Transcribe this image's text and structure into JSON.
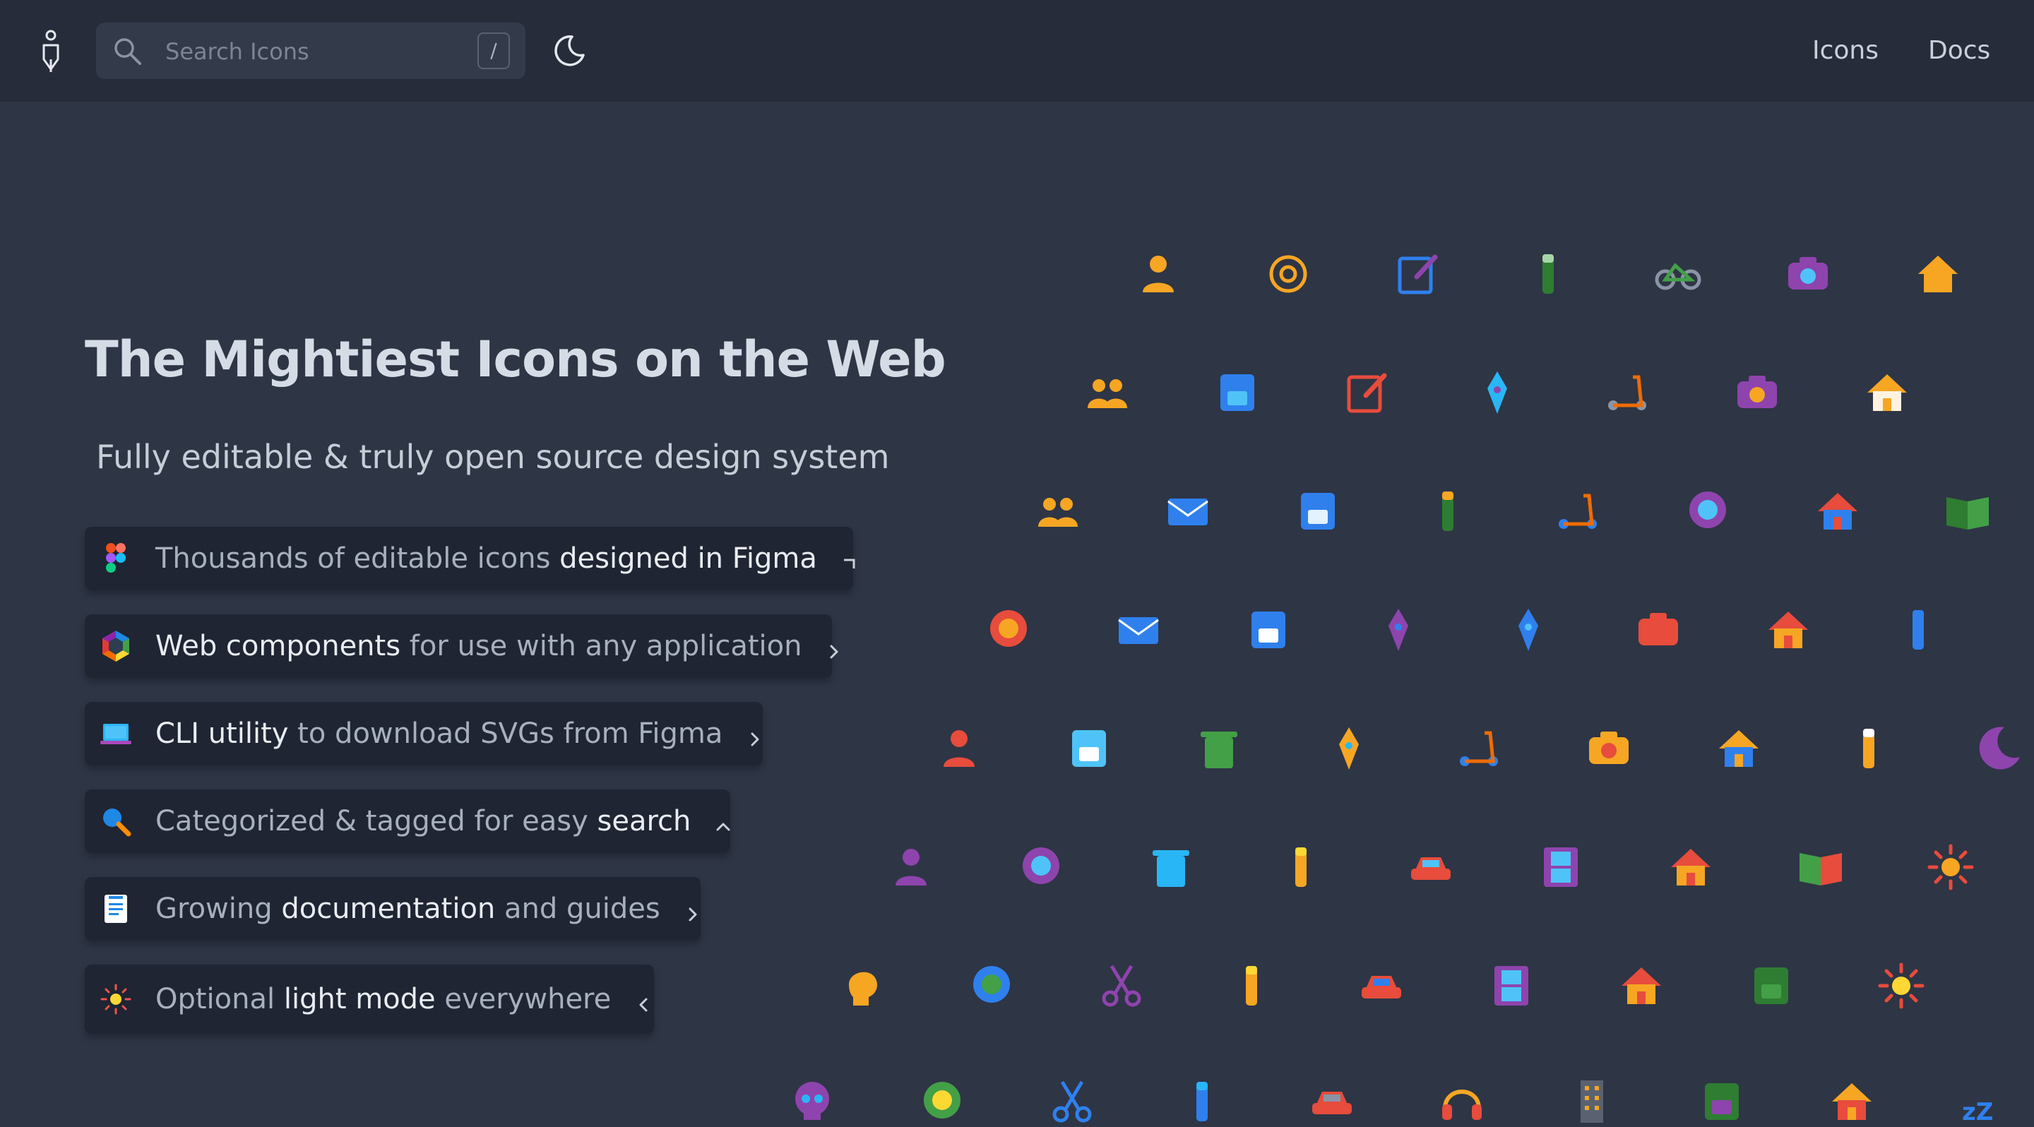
{
  "header": {
    "logo_icon": "pen-nib-logo-icon",
    "search": {
      "placeholder": "Search Icons",
      "value": "",
      "shortcut": "/"
    },
    "theme_toggle_icon": "moon-icon",
    "nav": [
      {
        "label": "Icons"
      },
      {
        "label": "Docs"
      }
    ]
  },
  "hero": {
    "title": "The Mightiest Icons on the Web",
    "subtitle": "Fully editable & truly open source design system",
    "features": [
      {
        "icon": "figma-icon",
        "parts": [
          {
            "t": "Thousands of editable icons ",
            "h": false
          },
          {
            "t": "designed in Figma",
            "h": true
          }
        ],
        "chevron": "corner-icon"
      },
      {
        "icon": "web-components-icon",
        "parts": [
          {
            "t": "Web components",
            "h": true
          },
          {
            "t": " for use with any application",
            "h": false
          }
        ],
        "chevron": "chevron-right-icon"
      },
      {
        "icon": "laptop-icon",
        "parts": [
          {
            "t": "CLI utility",
            "h": true
          },
          {
            "t": " to download SVGs from Figma",
            "h": false
          }
        ],
        "chevron": "chevron-right-icon"
      },
      {
        "icon": "magnifier-icon",
        "parts": [
          {
            "t": "Categorized & tagged for easy ",
            "h": false
          },
          {
            "t": "search",
            "h": true
          }
        ],
        "chevron": "chevron-up-icon"
      },
      {
        "icon": "document-icon",
        "parts": [
          {
            "t": "Growing ",
            "h": false
          },
          {
            "t": "documentation",
            "h": true
          },
          {
            "t": " and guides",
            "h": false
          }
        ],
        "chevron": "chevron-right-icon"
      },
      {
        "icon": "sun-icon",
        "parts": [
          {
            "t": "Optional ",
            "h": false
          },
          {
            "t": "light mode",
            "h": true
          },
          {
            "t": " everywhere",
            "h": false
          }
        ],
        "chevron": "chevron-left-icon"
      }
    ]
  },
  "showcase_icons": [
    [
      "user-icon",
      "at-sign-icon",
      "edit-icon",
      "marker-icon",
      "bicycle-icon",
      "camera-icon",
      "home-icon"
    ],
    [
      "users-icon",
      "id-card-icon",
      "edit-box-icon",
      "pen-nib-icon",
      "scooter-icon",
      "camera-flash-icon",
      "house-icon",
      "bookmark-icon"
    ],
    [
      "user-group-icon",
      "mail-icon",
      "floppy-disk-icon",
      "brush-icon",
      "electric-scooter-icon",
      "camera-lens-icon",
      "house-drop-icon",
      "book-open-icon"
    ],
    [
      "user-circle-icon",
      "mail-open-icon",
      "save-icon",
      "signature-icon",
      "vape-icon",
      "video-camera-icon",
      "house-fire-icon",
      "pencil-thin-icon"
    ],
    [
      "user-chat-icon",
      "clipboard-icon",
      "bin-icon",
      "paint-brush-icon",
      "motor-scooter-icon",
      "video-recorder-icon",
      "house-flood-icon",
      "ruler-icon",
      "moon-crescent-icon"
    ],
    [
      "user-hood-icon",
      "chat-circle-icon",
      "trash-icon",
      "pencil-icon",
      "car-icon",
      "film-icon",
      "garage-icon",
      "books-icon",
      "sun-burst-icon"
    ],
    [
      "head-icon",
      "chat-bubble-icon",
      "scissors-icon",
      "crayon-icon",
      "car-wash-icon",
      "film-strip-icon",
      "barn-icon",
      "book-icon",
      "sun-icon",
      "alarm-icon"
    ],
    [
      "skull-icon",
      "message-icon",
      "scissors-alt-icon",
      "pen-icon",
      "eraser-icon",
      "headphones-icon",
      "building-icon",
      "book-globe-icon",
      "sunrise-icon",
      "sleep-icon"
    ]
  ]
}
